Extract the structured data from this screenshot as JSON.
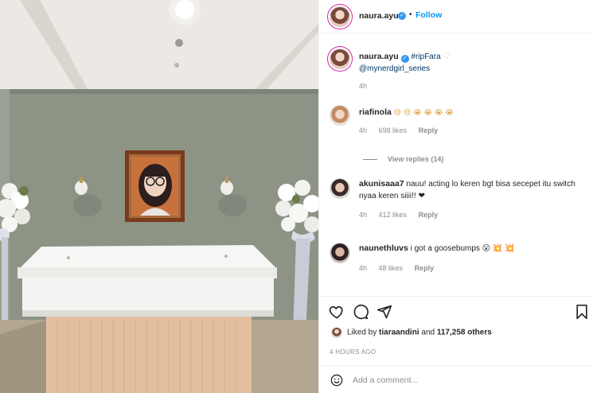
{
  "post": {
    "author": "naura.ayu",
    "follow_label": "Follow",
    "dot": "•"
  },
  "caption": {
    "username": "naura.ayu",
    "hashtag": "#ripFara",
    "heart": "♡",
    "mention": "@mynerdgirl_series",
    "time": "4h"
  },
  "comments": [
    {
      "username": "riafinola",
      "text": "😢 😢 😭 😭 😭 😭",
      "time": "4h",
      "likes": "698 likes",
      "reply": "Reply",
      "view_replies": "View replies (14)"
    },
    {
      "username": "akunisaaa7",
      "text": "nauu! acting lo keren bgt bisa secepet itu switch nyaa keren siiii!! ❤",
      "time": "4h",
      "likes": "412 likes",
      "reply": "Reply"
    },
    {
      "username": "naunethluvs",
      "text": "i got a goosebumps 😮 💥 💥",
      "time": "4h",
      "likes": "48 likes",
      "reply": "Reply"
    }
  ],
  "likes_summary": {
    "prefix": "Liked by",
    "user": "tiaraandini",
    "middle": "and",
    "count": "117,258 others"
  },
  "timestamp": "4 HOURS AGO",
  "add_comment": {
    "placeholder": "Add a comment..."
  },
  "icons": [
    "heart-icon",
    "comment-icon",
    "share-icon",
    "bookmark-icon",
    "smile-icon",
    "verified-icon"
  ],
  "colors": {
    "accent": "#0095f6",
    "verified": "#3897f0",
    "text": "#262626",
    "muted": "#8e8e8e"
  }
}
